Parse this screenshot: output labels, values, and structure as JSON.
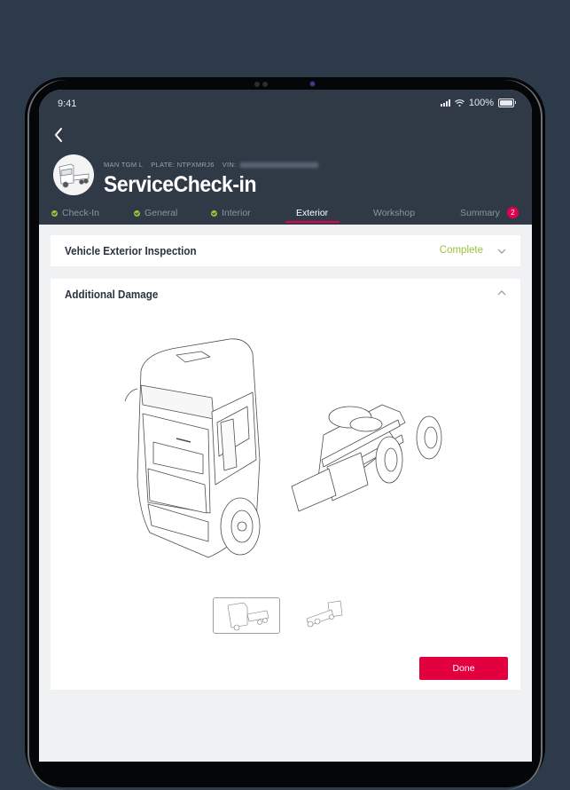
{
  "status_bar": {
    "time": "9:41",
    "battery": "100%"
  },
  "header": {
    "back_icon": "chevron-left-icon",
    "vehicle_model": "MAN TGM L",
    "plate": "PLATE: NTPXMRJ6",
    "vin_label": "VIN:",
    "title": "ServiceCheck-in"
  },
  "tabs": [
    {
      "label": "Check-In",
      "completed": true,
      "active": false
    },
    {
      "label": "General",
      "completed": true,
      "active": false
    },
    {
      "label": "Interior",
      "completed": true,
      "active": false
    },
    {
      "label": "Exterior",
      "completed": false,
      "active": true
    },
    {
      "label": "Workshop",
      "completed": false,
      "active": false
    },
    {
      "label": "Summary",
      "completed": false,
      "active": false,
      "badge": "2"
    }
  ],
  "sections": {
    "exterior_inspection": {
      "title": "Vehicle Exterior Inspection",
      "status": "Complete",
      "expanded": false
    },
    "additional_damage": {
      "title": "Additional Damage",
      "expanded": true
    }
  },
  "views": [
    {
      "name": "front-left view",
      "selected": true
    },
    {
      "name": "rear-right view",
      "selected": false
    }
  ],
  "done_label": "Done",
  "colors": {
    "accent": "#e2003f",
    "success": "#9bc33b",
    "header_bg": "#303a47"
  }
}
